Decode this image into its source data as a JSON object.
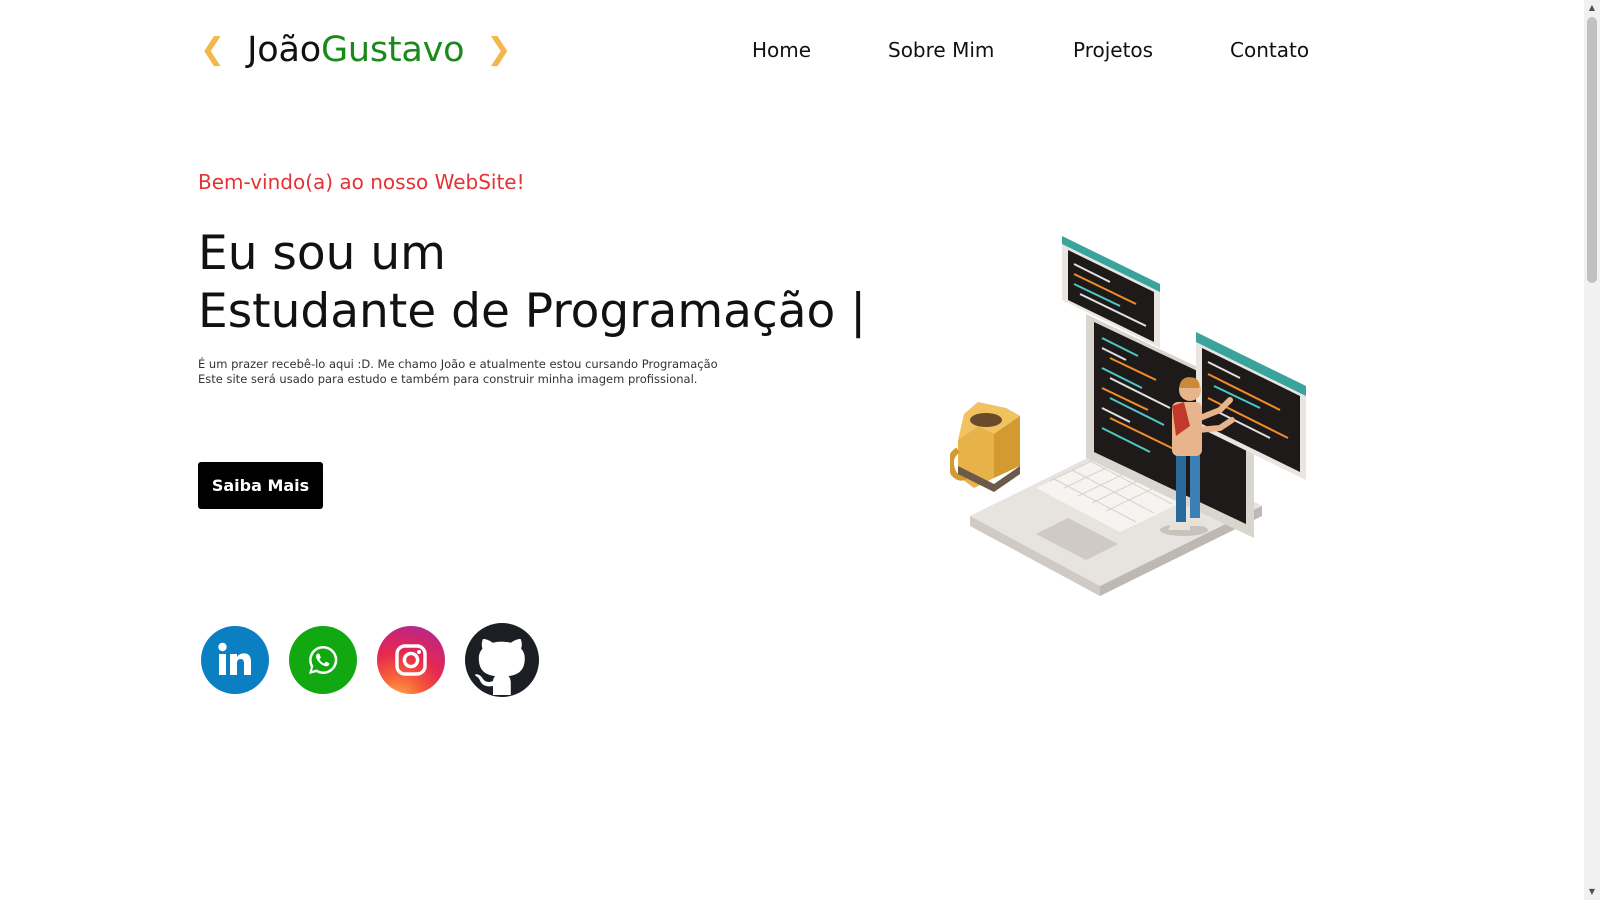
{
  "header": {
    "logo_first": "João",
    "logo_last": "Gustavo",
    "nav": {
      "home": "Home",
      "sobre": "Sobre Mim",
      "projetos": "Projetos",
      "contato": "Contato"
    }
  },
  "hero": {
    "welcome": "Bem-vindo(a) ao nosso WebSite!",
    "headline_line1": "Eu sou um",
    "headline_line2": "Estudante de Programação |",
    "desc_line1": "É um prazer recebê-lo aqui :D. Me chamo João e atualmente estou cursando Programação",
    "desc_line2": "Este site será usado para estudo e também para construir minha imagem profissional.",
    "button_label": "Saiba Mais"
  },
  "social": {
    "icons": [
      "linkedin-icon",
      "whatsapp-icon",
      "instagram-icon",
      "github-icon"
    ]
  },
  "colors": {
    "accent_red": "#e63232",
    "accent_green": "#1a8a1a",
    "chevron_yellow": "#f2b84b",
    "linkedin": "#0a7fc2",
    "whatsapp": "#12a812",
    "github": "#1b1f23"
  }
}
